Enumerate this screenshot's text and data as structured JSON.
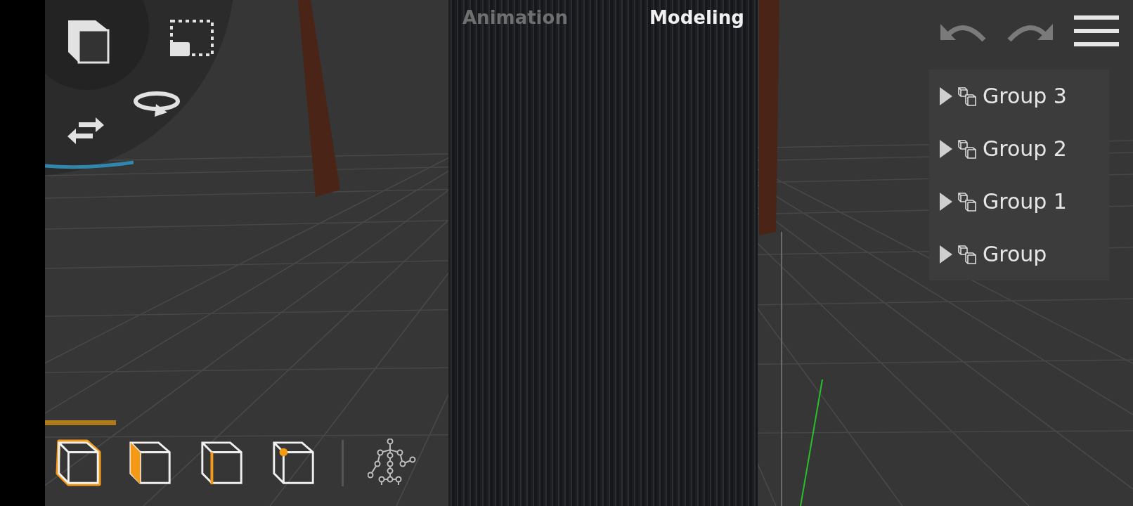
{
  "mode_tabs": [
    {
      "label": "Animation",
      "selected": false
    },
    {
      "label": "Modeling",
      "selected": true
    }
  ],
  "outliner": {
    "items": [
      {
        "label": "Group 3",
        "expanded": false
      },
      {
        "label": "Group 2",
        "expanded": false
      },
      {
        "label": "Group 1",
        "expanded": false
      },
      {
        "label": "Group",
        "expanded": false
      }
    ]
  },
  "selection_modes": [
    {
      "kind": "object",
      "selected": true
    },
    {
      "kind": "face",
      "selected": false
    },
    {
      "kind": "edge",
      "selected": false
    },
    {
      "kind": "vertex",
      "selected": false
    }
  ]
}
